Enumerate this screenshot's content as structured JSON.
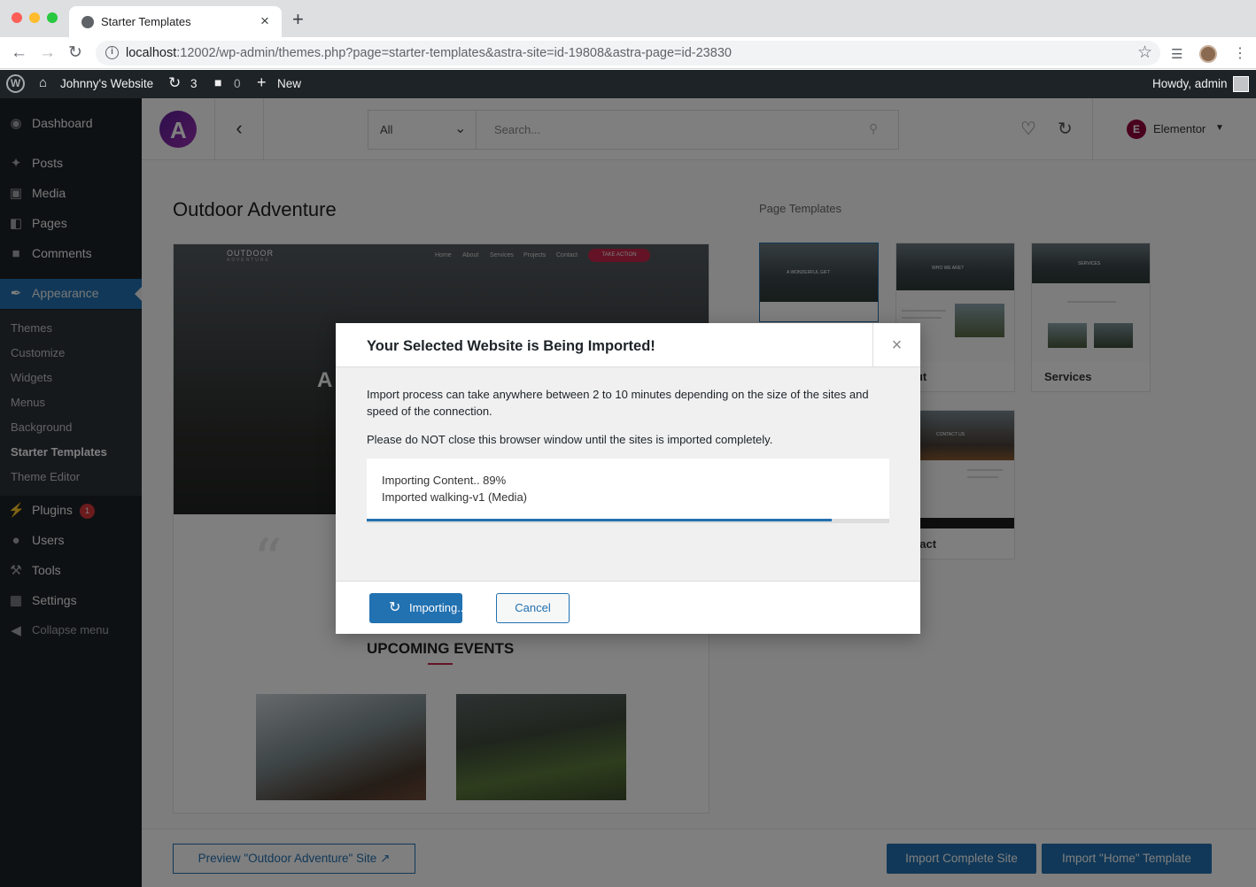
{
  "browser": {
    "tab_title": "Starter Templates",
    "url_host": "localhost",
    "url_rest": ":12002/wp-admin/themes.php?page=starter-templates&astra-site=id-19808&astra-page=id-23830",
    "new_tab_icon": "+",
    "tab_close_icon": "×"
  },
  "adminbar": {
    "site_name": "Johnny's Website",
    "updates_count": "3",
    "comments_count": "0",
    "new_label": "New",
    "howdy": "Howdy, admin"
  },
  "sidebar": {
    "dashboard": "Dashboard",
    "posts": "Posts",
    "media": "Media",
    "pages": "Pages",
    "comments": "Comments",
    "appearance": "Appearance",
    "submenu": [
      "Themes",
      "Customize",
      "Widgets",
      "Menus",
      "Background",
      "Starter Templates",
      "Theme Editor"
    ],
    "plugins": "Plugins",
    "plugins_badge": "1",
    "users": "Users",
    "tools": "Tools",
    "settings": "Settings",
    "collapse": "Collapse menu"
  },
  "header": {
    "filter_selected": "All",
    "search_placeholder": "Search...",
    "page_builder": "Elementor"
  },
  "site": {
    "title": "Outdoor Adventure",
    "page_templates_heading": "Page Templates",
    "hero_brand": "OUTDOOR",
    "hero_brand_sub": "ADVENTURE",
    "hero_nav": [
      "Home",
      "About",
      "Services",
      "Projects",
      "Contact"
    ],
    "hero_button": "TAKE ACTION",
    "hero_letter": "A",
    "events_title": "UPCOMING EVENTS",
    "thumbnails": [
      {
        "label": "",
        "caption": "A WONDERFUL GIFT"
      },
      {
        "label": "out",
        "caption": "WHO WE ARE?"
      },
      {
        "label": "Services",
        "caption": "SERVICES"
      },
      {
        "label": "ntact",
        "caption": "CONTACT US"
      }
    ]
  },
  "footer": {
    "preview_button": "Preview \"Outdoor Adventure\" Site",
    "import_site_button": "Import Complete Site",
    "import_template_button": "Import \"Home\" Template"
  },
  "modal": {
    "title": "Your Selected Website is Being Imported!",
    "para1": "Import process can take anywhere between 2 to 10 minutes depending on the size of the sites and speed of the connection.",
    "para2": "Please do NOT close this browser window until the sites is imported completely.",
    "log_line1": "Importing Content.. 89%",
    "log_line2": "Imported walking-v1 (Media)",
    "progress_percent": 89,
    "importing_button": "Importing..",
    "cancel_button": "Cancel"
  },
  "colors": {
    "wp_blue": "#2271b1",
    "admin_dark": "#1d2327",
    "accent_red": "#c7264a"
  }
}
